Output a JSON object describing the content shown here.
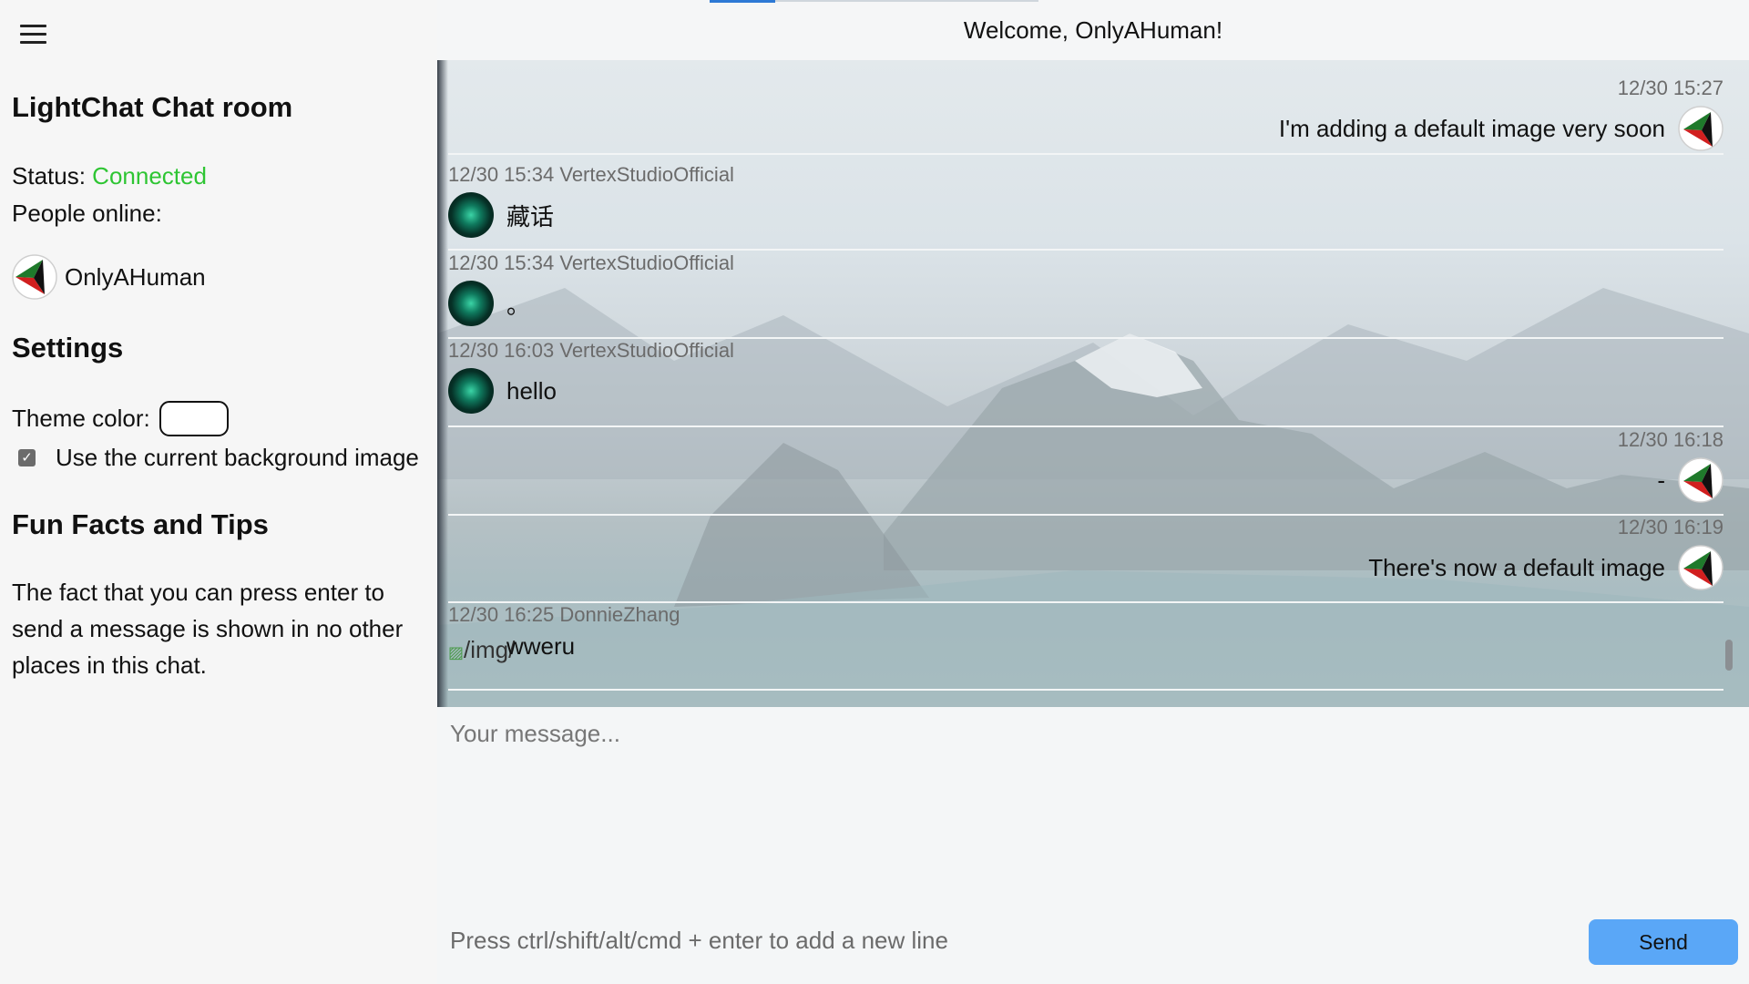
{
  "window": {
    "welcome": "Welcome, OnlyAHuman!"
  },
  "sidebar": {
    "title": "LightChat Chat room",
    "status_label": "Status:",
    "status_value": "Connected",
    "status_color": "#2ec533",
    "people_label": "People online:",
    "people": [
      {
        "name": "OnlyAHuman",
        "avatar": "tri-flag-icon"
      }
    ],
    "settings_title": "Settings",
    "theme_label": "Theme color:",
    "bg_option_label": "Use the current background image",
    "bg_option_checked": true,
    "tips_title": "Fun Facts and Tips",
    "tip_text": "The fact that you can press enter to send a message is shown in no other places in this chat."
  },
  "messages": [
    {
      "side": "right",
      "time": "12/30 15:27",
      "user": "",
      "text": "I'm adding a default image very soon",
      "avatar": "tri-flag-icon"
    },
    {
      "side": "left",
      "time": "12/30 15:34",
      "user": "VertexStudioOfficial",
      "text": "藏话",
      "avatar": "aurora-icon"
    },
    {
      "side": "left",
      "time": "12/30 15:34",
      "user": "VertexStudioOfficial",
      "text": "。",
      "avatar": "aurora-icon"
    },
    {
      "side": "left",
      "time": "12/30 16:03",
      "user": "VertexStudioOfficial",
      "text": "hello",
      "avatar": "aurora-icon"
    },
    {
      "side": "right",
      "time": "12/30 16:18",
      "user": "",
      "text": "-",
      "avatar": "tri-flag-icon"
    },
    {
      "side": "right",
      "time": "12/30 16:19",
      "user": "",
      "text": "There's now a default image",
      "avatar": "tri-flag-icon"
    },
    {
      "side": "left",
      "time": "12/30 16:25",
      "user": "DonnieZhang",
      "text": "wweru",
      "avatar": "broken-image-icon",
      "alt": "/img/"
    }
  ],
  "input": {
    "placeholder": "Your message...",
    "hint": "Press ctrl/shift/alt/cmd + enter to add a new line",
    "send_label": "Send",
    "send_color": "#5aa7f7"
  }
}
